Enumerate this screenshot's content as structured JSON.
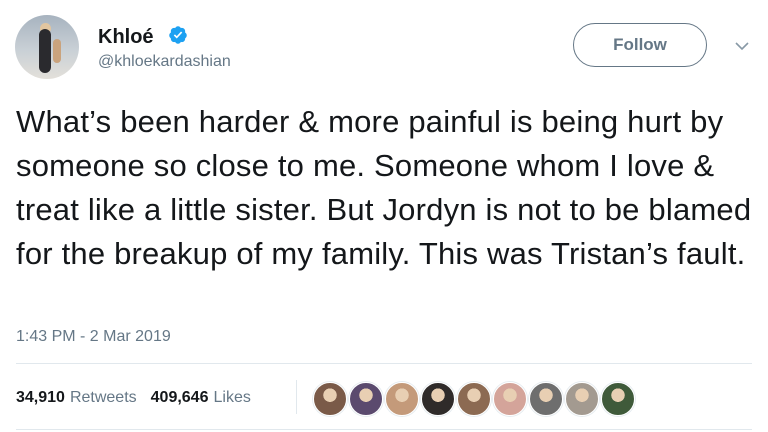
{
  "tweet": {
    "author_name": "Khloé",
    "author_handle": "@khloekardashian",
    "follow_label": "Follow",
    "text": "What’s been harder & more painful is being hurt by someone so close to me. Someone whom I love & treat like a little sister. But Jordyn is not to be blamed for the breakup of my family. This was Tristan’s fault.",
    "timestamp": "1:43 PM - 2 Mar 2019",
    "retweets_count": "34,910",
    "retweets_label": "Retweets",
    "likes_count": "409,646",
    "likes_label": "Likes"
  },
  "colors": {
    "verified": "#1da1f2",
    "secondary_text": "#657786",
    "primary_text": "#14171a"
  },
  "icons": {
    "verified": "verified-badge-icon",
    "more": "chevron-down-icon"
  },
  "likers": [
    {
      "name": "liker-avatar-1",
      "color": "#7a5a48"
    },
    {
      "name": "liker-avatar-2",
      "color": "#5b4a6e"
    },
    {
      "name": "liker-avatar-3",
      "color": "#c49a7a"
    },
    {
      "name": "liker-avatar-4",
      "color": "#2f2b2a"
    },
    {
      "name": "liker-avatar-5",
      "color": "#8c6a52"
    },
    {
      "name": "liker-avatar-6",
      "color": "#d4a49a"
    },
    {
      "name": "liker-avatar-7",
      "color": "#6e6e6e"
    },
    {
      "name": "liker-avatar-8",
      "color": "#a39a90"
    },
    {
      "name": "liker-avatar-9",
      "color": "#3f5a3a"
    }
  ]
}
